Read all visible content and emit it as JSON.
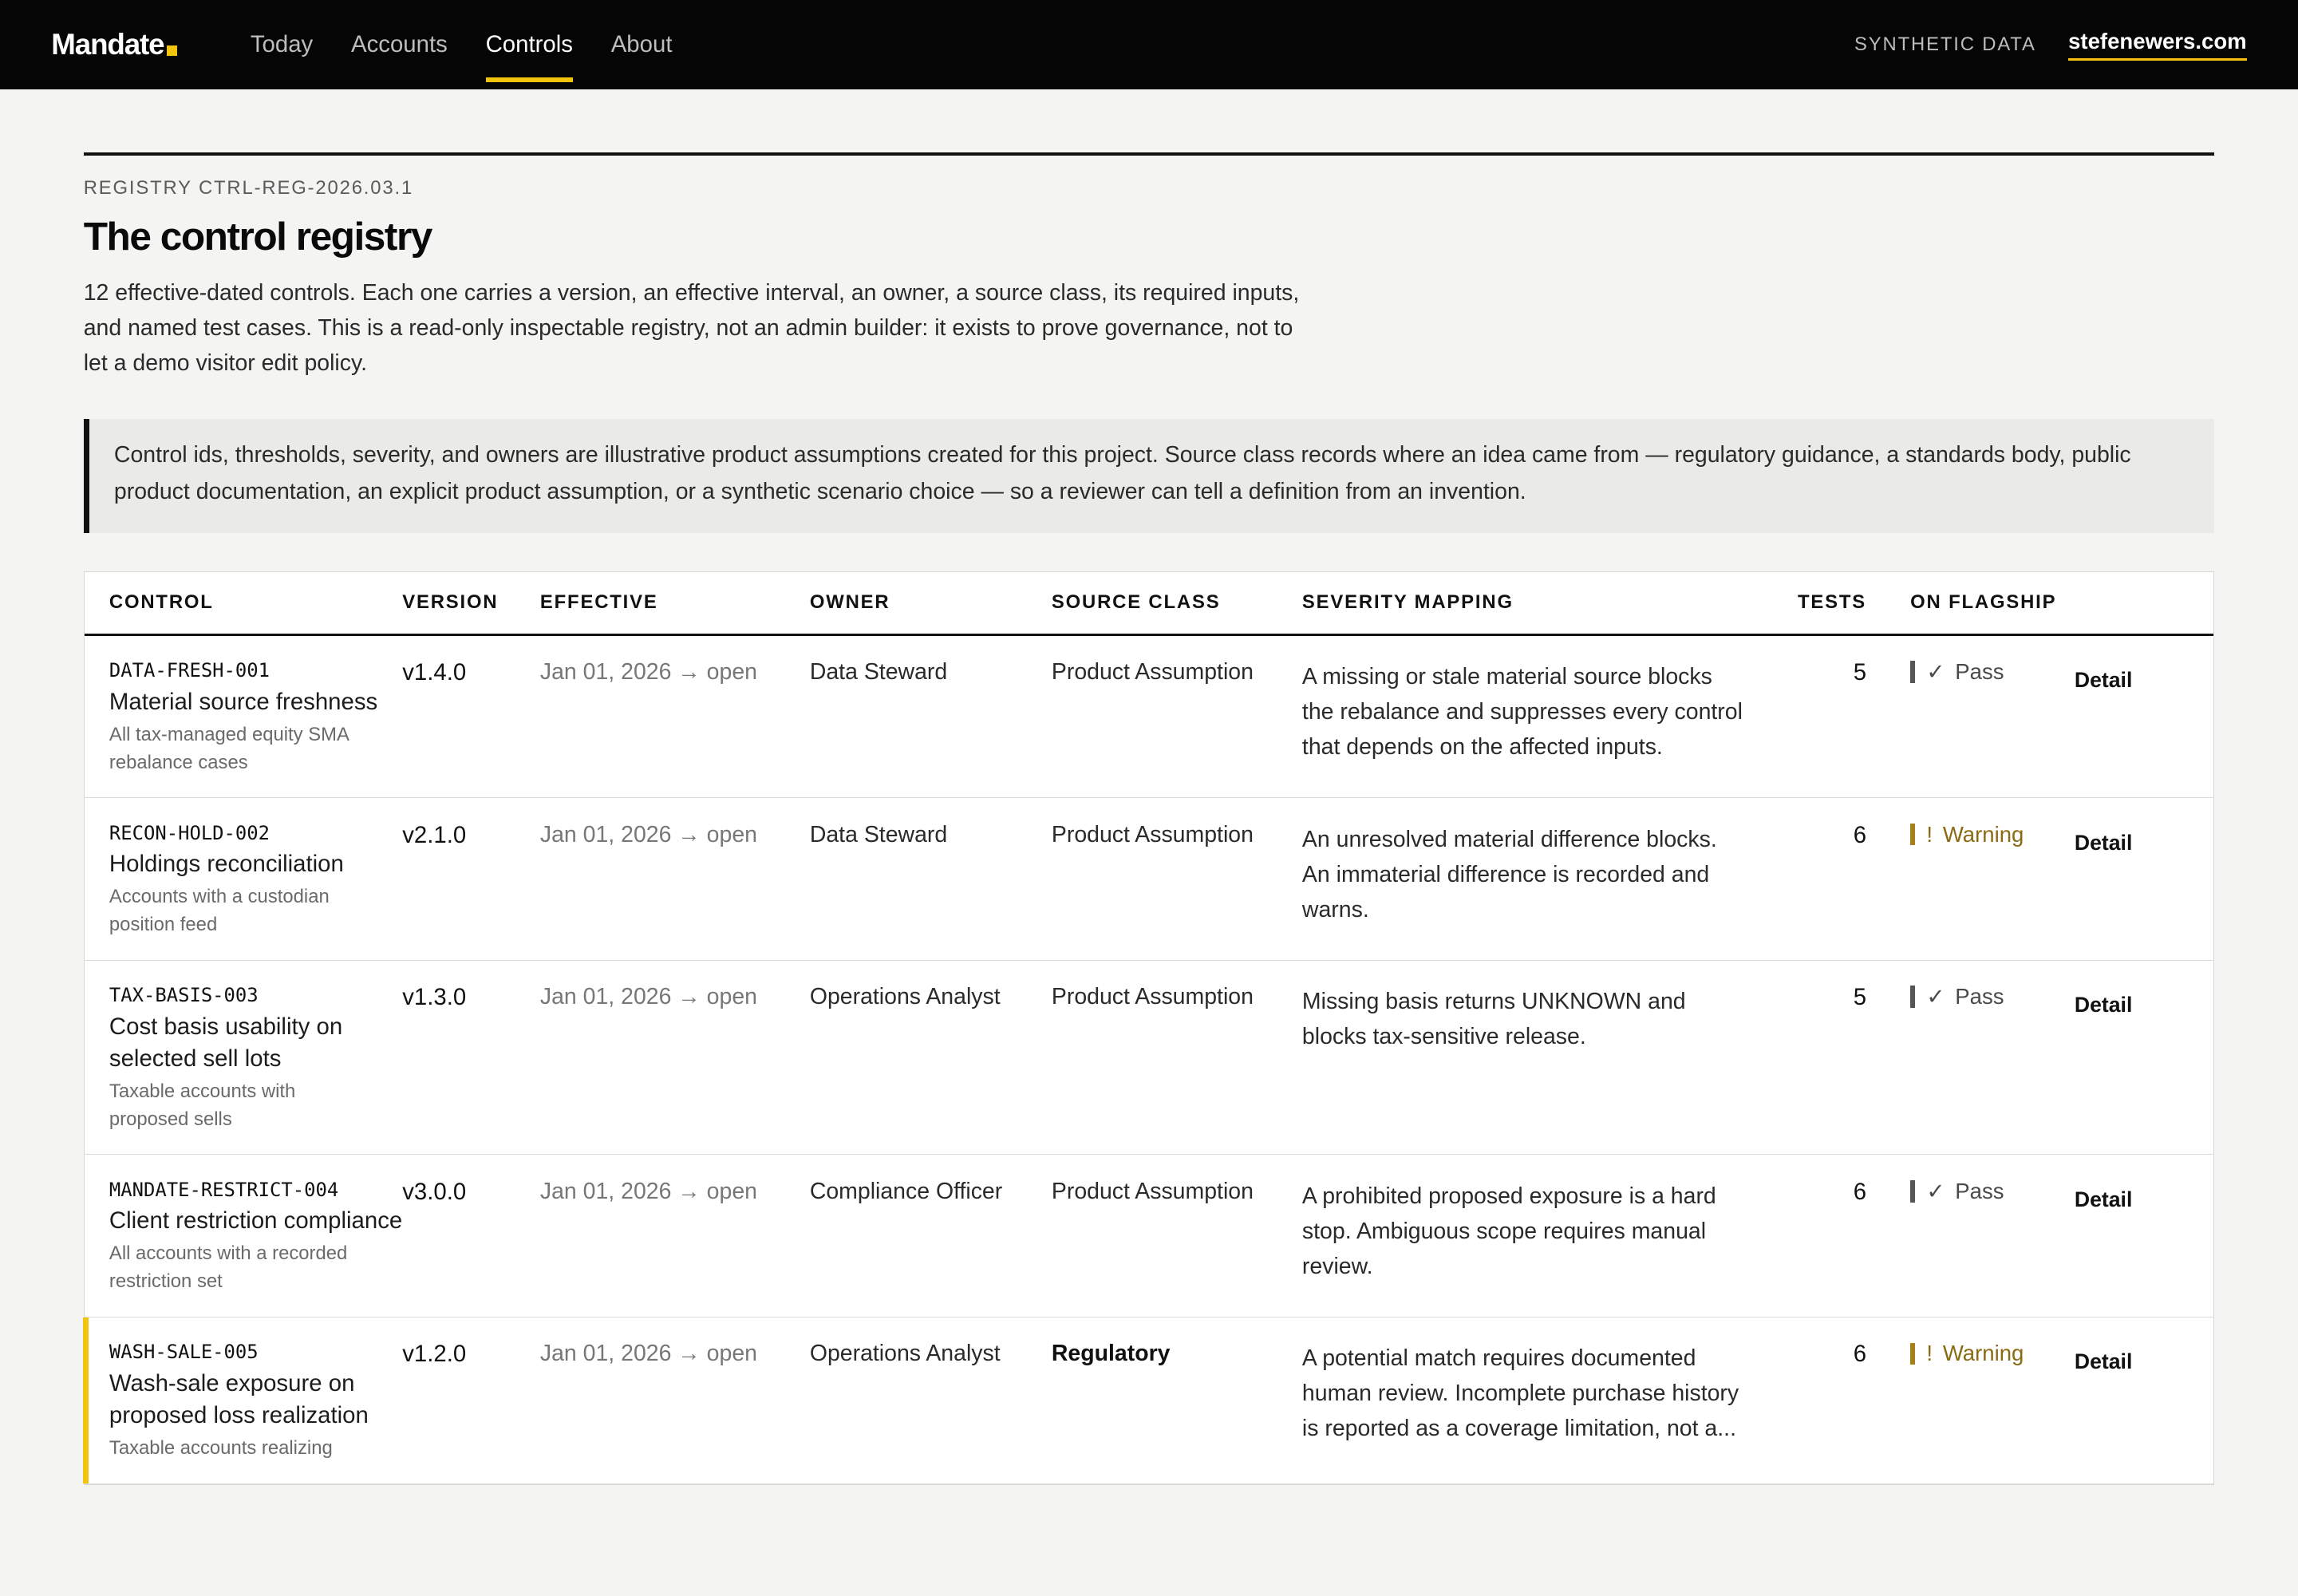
{
  "nav": {
    "brand": "Mandate",
    "links": [
      {
        "label": "Today"
      },
      {
        "label": "Accounts"
      },
      {
        "label": "Controls"
      },
      {
        "label": "About"
      }
    ],
    "synthetic_label": "SYNTHETIC DATA",
    "site_link": "stefenewers.com"
  },
  "header": {
    "registry_id": "REGISTRY CTRL-REG-2026.03.1",
    "title": "The control registry",
    "intro": "12 effective-dated controls. Each one carries a version, an effective interval, an owner, a source class, its required inputs, and named test cases. This is a read-only inspectable registry, not an admin builder: it exists to prove governance, not to let a demo visitor edit policy.",
    "callout": "Control ids, thresholds, severity, and owners are illustrative product assumptions created for this project. Source class records where an idea came from — regulatory guidance, a standards body, public product documentation, an explicit product assumption, or a synthetic scenario choice — so a reviewer can tell a definition from an invention."
  },
  "table": {
    "columns": {
      "control": "CONTROL",
      "version": "VERSION",
      "effective": "EFFECTIVE",
      "owner": "OWNER",
      "source": "SOURCE CLASS",
      "severity": "SEVERITY MAPPING",
      "tests": "TESTS",
      "flagship": "ON FLAGSHIP"
    },
    "rows": [
      {
        "id": "DATA-FRESH-001",
        "name": "Material source freshness",
        "scope": "All tax-managed equity SMA rebalance cases",
        "version": "v1.4.0",
        "effective": "Jan 01, 2026 → open",
        "owner": "Data Steward",
        "source": "Product Assumption",
        "severity": "A missing or stale material source blocks the rebalance and suppresses every control that depends on the affected inputs.",
        "tests": "5",
        "status_symbol": "✓",
        "status": "Pass",
        "detail": "Detail"
      },
      {
        "id": "RECON-HOLD-002",
        "name": "Holdings reconciliation",
        "scope": "Accounts with a custodian position feed",
        "version": "v2.1.0",
        "effective": "Jan 01, 2026 → open",
        "owner": "Data Steward",
        "source": "Product Assumption",
        "severity": "An unresolved material difference blocks. An immaterial difference is recorded and warns.",
        "tests": "6",
        "status_symbol": "!",
        "status": "Warning",
        "detail": "Detail"
      },
      {
        "id": "TAX-BASIS-003",
        "name": "Cost basis usability on selected sell lots",
        "scope": "Taxable accounts with proposed sells",
        "version": "v1.3.0",
        "effective": "Jan 01, 2026 → open",
        "owner": "Operations Analyst",
        "source": "Product Assumption",
        "severity": "Missing basis returns UNKNOWN and blocks tax-sensitive release.",
        "tests": "5",
        "status_symbol": "✓",
        "status": "Pass",
        "detail": "Detail"
      },
      {
        "id": "MANDATE-RESTRICT-004",
        "name": "Client restriction compliance",
        "scope": "All accounts with a recorded restriction set",
        "version": "v3.0.0",
        "effective": "Jan 01, 2026 → open",
        "owner": "Compliance Officer",
        "source": "Product Assumption",
        "severity": "A prohibited proposed exposure is a hard stop. Ambiguous scope requires manual review.",
        "tests": "6",
        "status_symbol": "✓",
        "status": "Pass",
        "detail": "Detail"
      },
      {
        "id": "WASH-SALE-005",
        "name": "Wash-sale exposure on proposed loss realization",
        "scope": "Taxable accounts realizing",
        "version": "v1.2.0",
        "effective": "Jan 01, 2026 → open",
        "owner": "Operations Analyst",
        "source": "Regulatory",
        "severity": "A potential match requires documented human review. Incomplete purchase history is reported as a coverage limitation, not a...",
        "tests": "6",
        "status_symbol": "!",
        "status": "Warning",
        "detail": "Detail"
      }
    ]
  },
  "colors": {
    "accent": "#f2c40c",
    "nav_bg": "#050505",
    "page_bg": "#f4f4f2",
    "warning": "#8a6a13"
  }
}
